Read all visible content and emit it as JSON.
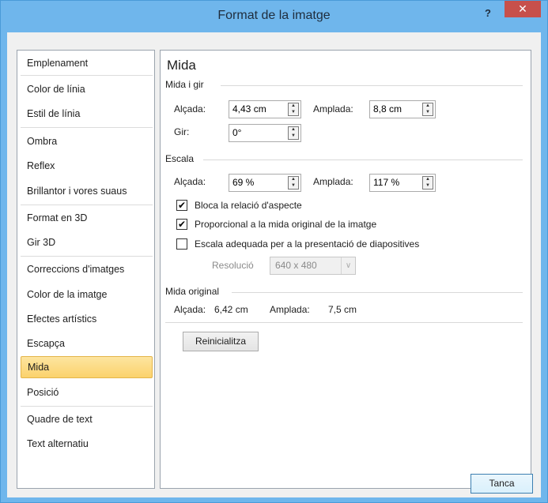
{
  "window": {
    "title": "Format de la imatge",
    "help_label": "?",
    "close_label": "✕"
  },
  "nav": {
    "items": [
      {
        "label": "Emplenament"
      },
      {
        "label": "Color de línia"
      },
      {
        "label": "Estil de línia"
      },
      {
        "label": "Ombra"
      },
      {
        "label": "Reflex"
      },
      {
        "label": "Brillantor i vores suaus"
      },
      {
        "label": "Format en 3D"
      },
      {
        "label": "Gir 3D"
      },
      {
        "label": "Correccions d'imatges"
      },
      {
        "label": "Color de la imatge"
      },
      {
        "label": "Efectes artístics"
      },
      {
        "label": "Escapça"
      },
      {
        "label": "Mida"
      },
      {
        "label": "Posició"
      },
      {
        "label": "Quadre de text"
      },
      {
        "label": "Text alternatiu"
      }
    ],
    "selected": "Mida"
  },
  "pane": {
    "title": "Mida",
    "size_rotate": {
      "heading": "Mida i gir",
      "height_label": "Alçada:",
      "height_value": "4,43 cm",
      "width_label": "Amplada:",
      "width_value": "8,8 cm",
      "rotation_label": "Gir:",
      "rotation_value": "0°"
    },
    "scale": {
      "heading": "Escala",
      "height_label": "Alçada:",
      "height_value": "69 %",
      "width_label": "Amplada:",
      "width_value": "117 %",
      "lock_aspect_label": "Bloca la relació d'aspecte",
      "lock_aspect_checked": true,
      "relative_original_label": "Proporcional a la mida original de la imatge",
      "relative_original_checked": true,
      "best_scale_label": "Escala adequada per a la presentació de diapositives",
      "best_scale_checked": false,
      "resolution_label": "Resolució",
      "resolution_value": "640 x 480"
    },
    "original": {
      "heading": "Mida original",
      "height_label": "Alçada:",
      "height_value": "6,42 cm",
      "width_label": "Amplada:",
      "width_value": "7,5 cm",
      "reset_label": "Reinicialitza"
    }
  },
  "footer": {
    "close_label": "Tanca"
  }
}
